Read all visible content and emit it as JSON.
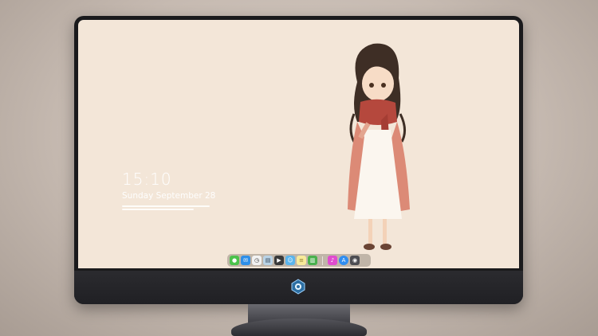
{
  "lockscreen": {
    "time": "15:10",
    "date": "Sunday September 28"
  },
  "dock": {
    "items": [
      {
        "name": "messages-icon",
        "color": "#4cc24c",
        "glyph": "●"
      },
      {
        "name": "mail-icon",
        "color": "#2e8fe8",
        "glyph": "✉"
      },
      {
        "name": "clock-icon",
        "color": "#f2f2f2",
        "glyph": "◷"
      },
      {
        "name": "preview-icon",
        "color": "#b9d3e6",
        "glyph": "▤"
      },
      {
        "name": "clapperboard-icon",
        "color": "#3a3a3a",
        "glyph": "▶"
      },
      {
        "name": "finder-icon",
        "color": "#5ab4ec",
        "glyph": "☺"
      },
      {
        "name": "notes-icon",
        "color": "#f8ea9a",
        "glyph": "≡"
      },
      {
        "name": "numbers-icon",
        "color": "#49b04d",
        "glyph": "▥"
      },
      {
        "name": "itunes-icon",
        "color": "#e04ccf",
        "glyph": "♪"
      },
      {
        "name": "app-store-icon",
        "color": "#2f8df0",
        "glyph": "A"
      },
      {
        "name": "camera-icon",
        "color": "#4d4d52",
        "glyph": "◉"
      }
    ]
  },
  "colors": {
    "wallpaper": "#f3e6d8",
    "scarf": "#b5483d",
    "coat": "#dc8a76"
  }
}
